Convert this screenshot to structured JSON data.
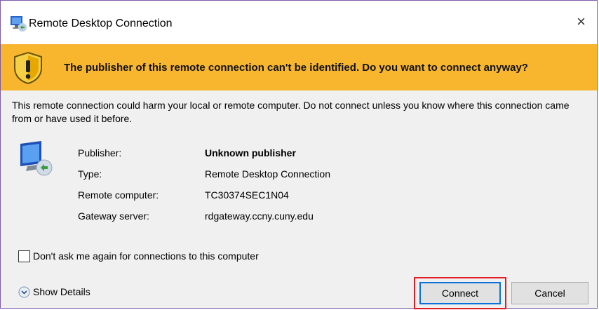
{
  "window": {
    "title": "Remote Desktop Connection",
    "close_glyph": "×",
    "icon": "remote-desktop-icon"
  },
  "warning": {
    "message": "The publisher of this remote connection can't be identified. Do you want to connect anyway?",
    "icon": "warning-shield-icon",
    "color": "#f8b62f"
  },
  "description": "This remote connection could harm your local or remote computer. Do not connect unless you know where this connection came from or have used it before.",
  "details": [
    {
      "label": "Publisher:",
      "value": "Unknown publisher"
    },
    {
      "label": "Type:",
      "value": "Remote Desktop Connection"
    },
    {
      "label": "Remote computer:",
      "value": "TC30374SEC1N04"
    },
    {
      "label": "Gateway server:",
      "value": "rdgateway.ccny.cuny.edu"
    }
  ],
  "checkbox": {
    "label": "Don't ask me again for connections to this computer",
    "checked": false
  },
  "show_details_label": "Show Details",
  "buttons": {
    "connect": "Connect",
    "cancel": "Cancel"
  },
  "accent_color": "#0a71d9",
  "highlight_color": "#e21d24"
}
